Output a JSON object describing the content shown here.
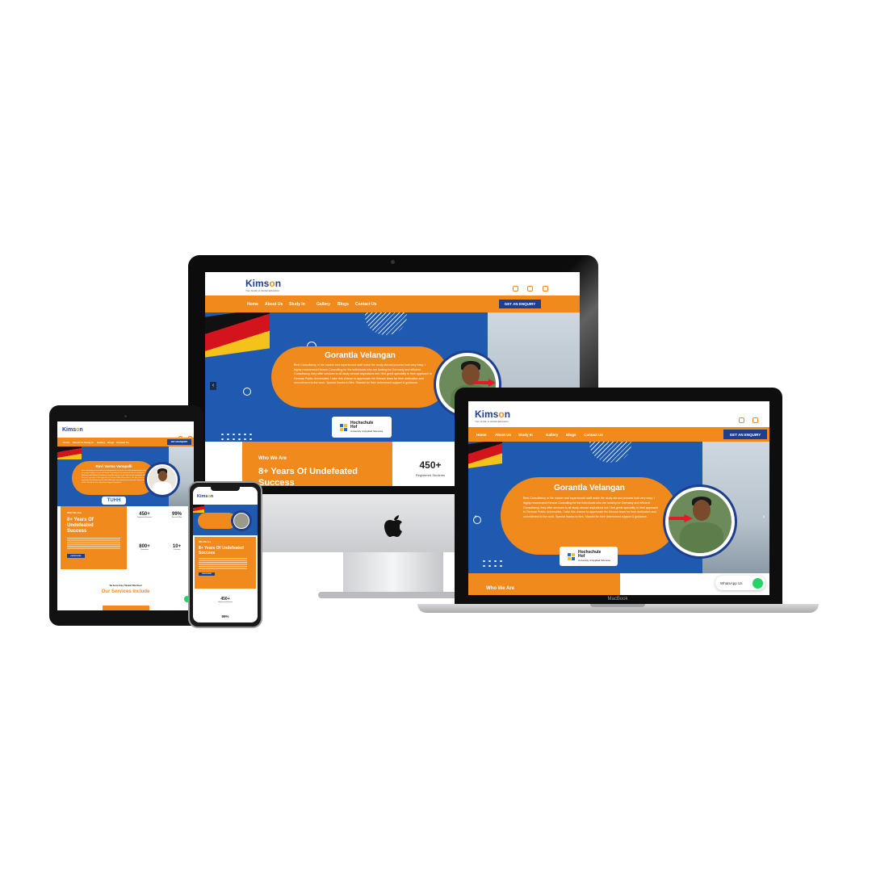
{
  "brand": {
    "name_prefix": "Kims",
    "name_mid": "o",
    "name_suffix": "n",
    "tagline": "Your Guide to Global Education"
  },
  "nav": {
    "items": [
      "Home",
      "About Us",
      "Study In",
      "Gallery",
      "Blogs",
      "Contact Us"
    ],
    "enquiry": "GET AN ENQUIRY"
  },
  "hero": {
    "name": "Gorantla Velangan",
    "quote": "Best Consultancy in the market and experienced staff make the study abroad process look very easy. I highly recommend Kimson Consulting for the individuals who are looking for Germany and efficient Consultancy, they offer services to all study abroad aspirations but I find great speciality in their approach to German Public Universities. I take this chance to appreciate the Kimson team for their dedication and commitment to the work. Special thanks to Mrs. Shanthi for their determined support & guidance.",
    "university_line1": "Hochschule",
    "university_line2": "Hof",
    "university_line3": "University of Applied Sciences"
  },
  "tablet_hero": {
    "name": "Ravi Varma Vanapalli",
    "logo": "TUHH"
  },
  "about": {
    "kicker": "Who We Are",
    "headline": "8+ Years Of Undefeated Success",
    "headline_cut": "Undefeated Success",
    "button": "KNOW MORE"
  },
  "stats": [
    {
      "value": "450+",
      "label": "Registered Students"
    },
    {
      "value": "99%",
      "label": "Success Rate"
    },
    {
      "value": "800+",
      "label": "Universities"
    },
    {
      "value": "10+",
      "label": "Countries"
    }
  ],
  "services": {
    "kicker": "We Serve Every Student Who Need",
    "title": "Our Services Include"
  },
  "whatsapp": {
    "label": "WhatsApp Us"
  },
  "device": {
    "laptop_label": "MacBook"
  },
  "colors": {
    "orange": "#f08a1c",
    "navy": "#1d3f8f",
    "hero_blue": "#1f5ab0"
  },
  "icons": [
    "facebook-icon",
    "instagram-icon",
    "linkedin-icon",
    "apple-logo-icon",
    "whatsapp-icon"
  ]
}
